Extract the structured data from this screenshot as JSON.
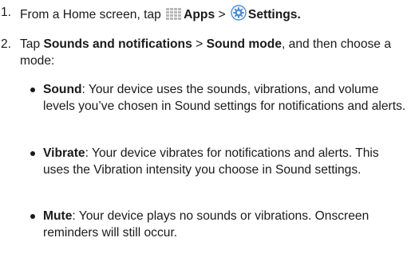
{
  "steps": [
    {
      "number": "1.",
      "prefix": "From a Home screen, tap",
      "apps_icon": "apps-grid-icon",
      "apps_label": "Apps",
      "separator": ">",
      "settings_icon": "gear-icon",
      "settings_label": "Settings",
      "end": "."
    },
    {
      "number": "2.",
      "prefix": "Tap",
      "item1": "Sounds and notifications",
      "separator": ">",
      "item2": "Sound mode",
      "suffix": ", and then choose a mode:"
    }
  ],
  "modes": [
    {
      "label": "Sound",
      "description": ": Your device uses the sounds, vibrations, and volume levels you’ve chosen in Sound settings for notifications and alerts."
    },
    {
      "label": "Vibrate",
      "description": ": Your device vibrates for notifications and alerts. This uses the Vibration intensity you choose in Sound settings."
    },
    {
      "label": "Mute",
      "description": ": Your device plays no sounds or vibrations. Onscreen reminders will still occur."
    }
  ],
  "colors": {
    "text": "#1a1a1a",
    "apps_icon": "#b8b8b8",
    "gear_icon": "#4a90d9"
  }
}
